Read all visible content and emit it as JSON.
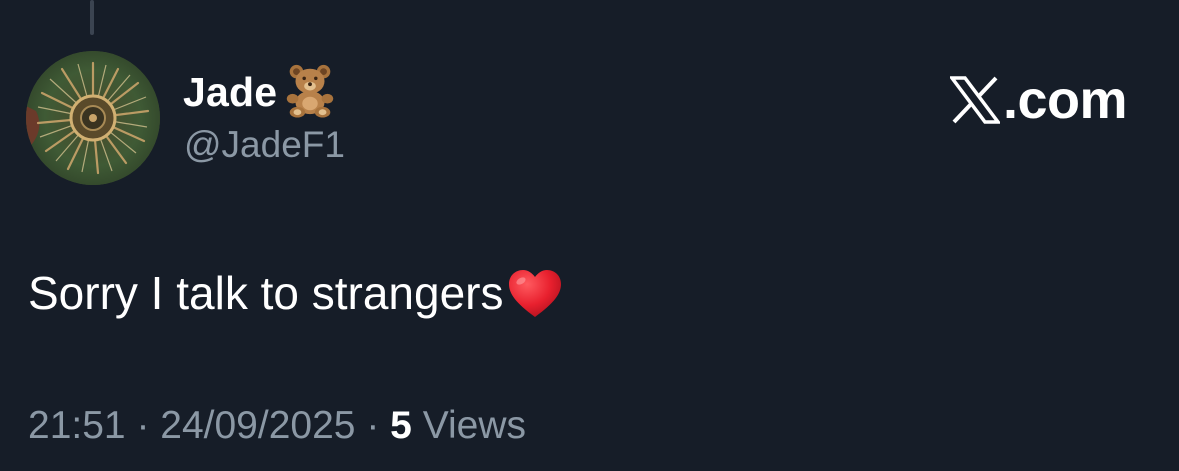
{
  "profile": {
    "display_name": "Jade",
    "handle": "@JadeF1",
    "name_emoji": "teddy-bear-icon"
  },
  "brand": {
    "logo": "x-logo-icon",
    "label": ".com"
  },
  "tweet": {
    "text": "Sorry I talk to strangers",
    "trailing_emoji": "red-heart-icon"
  },
  "meta": {
    "time": "21:51",
    "separator": " · ",
    "date": "24/09/2025",
    "views_count": "5",
    "views_label": " Views"
  },
  "colors": {
    "background": "#161d28",
    "primary_text": "#ffffff",
    "secondary_text": "#8b98a5",
    "heart": "#e8202e"
  }
}
